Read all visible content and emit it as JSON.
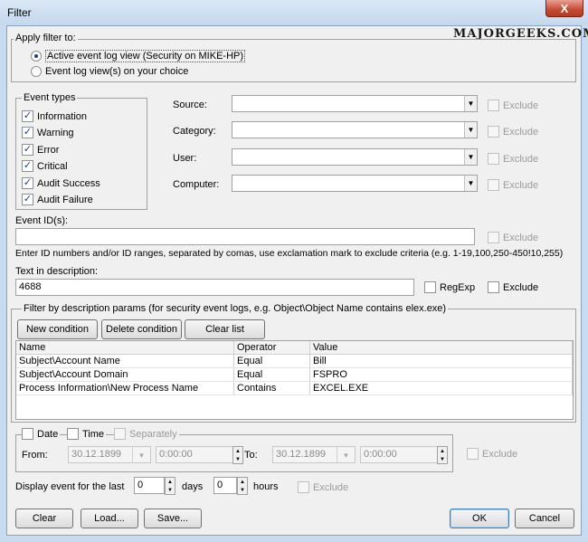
{
  "window": {
    "title": "Filter",
    "close_glyph": "X"
  },
  "watermark": "MAJORGEEKS.COM",
  "apply_filter": {
    "label": "Apply filter to:",
    "options": [
      {
        "label": "Active event log view (Security on MIKE-HP)",
        "selected": true
      },
      {
        "label": "Event log view(s) on your choice",
        "selected": false
      }
    ]
  },
  "event_types": {
    "title": "Event types",
    "items": [
      {
        "label": "Information",
        "checked": true
      },
      {
        "label": "Warning",
        "checked": true
      },
      {
        "label": "Error",
        "checked": true
      },
      {
        "label": "Critical",
        "checked": true
      },
      {
        "label": "Audit Success",
        "checked": true
      },
      {
        "label": "Audit Failure",
        "checked": true
      }
    ]
  },
  "fields": [
    {
      "label": "Source:",
      "exclude": "Exclude"
    },
    {
      "label": "Category:",
      "exclude": "Exclude"
    },
    {
      "label": "User:",
      "exclude": "Exclude"
    },
    {
      "label": "Computer:",
      "exclude": "Exclude"
    }
  ],
  "event_id": {
    "label": "Event ID(s):",
    "value": "",
    "exclude": "Exclude",
    "hint": "Enter ID numbers and/or ID ranges, separated by comas, use exclamation mark to exclude criteria (e.g. 1-19,100,250-450!10,255)"
  },
  "text_desc": {
    "label": "Text in description:",
    "value": "4688",
    "regexp": "RegExp",
    "exclude": "Exclude"
  },
  "desc_params": {
    "title": "Filter by description params (for security event logs, e.g. Object\\Object Name contains elex.exe)",
    "buttons": {
      "new": "New condition",
      "delete": "Delete condition",
      "clear": "Clear list"
    },
    "columns": [
      "Name",
      "Operator",
      "Value"
    ],
    "rows": [
      [
        "Subject\\Account Name",
        "Equal",
        "Bill"
      ],
      [
        "Subject\\Account Domain",
        "Equal",
        "FSPRO"
      ],
      [
        "Process Information\\New Process Name",
        "Contains",
        "EXCEL.EXE"
      ]
    ]
  },
  "datetime": {
    "date": "Date",
    "time": "Time",
    "separately": "Separately",
    "from_label": "From:",
    "from_date": "30.12.1899",
    "from_time": "0:00:00",
    "to_label": "To:",
    "to_date": "30.12.1899",
    "to_time": "0:00:00",
    "exclude": "Exclude"
  },
  "last": {
    "label": "Display event for the last",
    "days_value": "0",
    "days_label": "days",
    "hours_value": "0",
    "hours_label": "hours",
    "exclude": "Exclude"
  },
  "footer": {
    "clear": "Clear",
    "load": "Load...",
    "save": "Save...",
    "ok": "OK",
    "cancel": "Cancel"
  }
}
